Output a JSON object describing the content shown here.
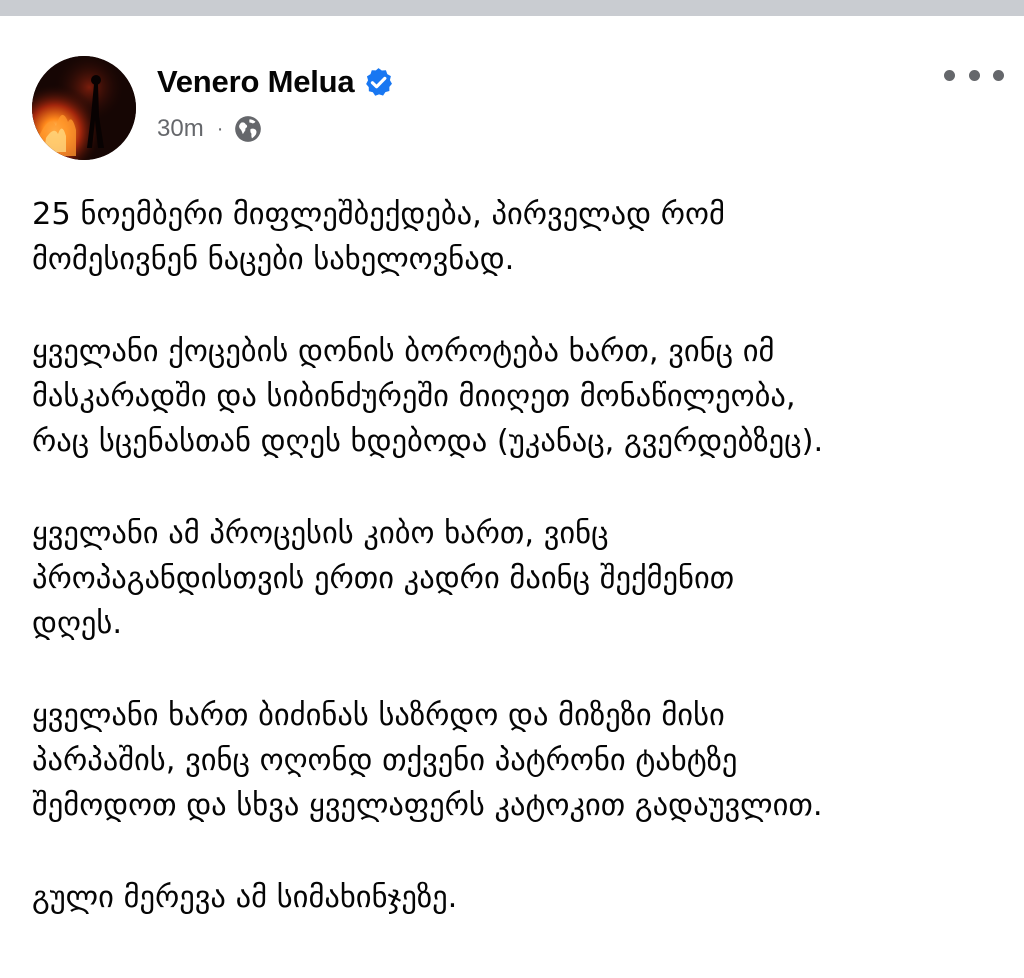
{
  "post": {
    "author": {
      "name": "Venero Melua",
      "verified": true,
      "avatar_icon": "profile-photo-fire"
    },
    "meta": {
      "time": "30m",
      "separator": "·",
      "audience_icon": "globe-icon"
    },
    "menu_icon": "more-options-icon",
    "paragraphs": [
      {
        "lines": [
          "25 ნოემბერი მიფლეშბექდება, პირველად რომ",
          "მომესივნენ ნაცები სახელოვნად."
        ]
      },
      {
        "lines": [
          "ყველანი ქოცების დონის ბოროტება ხართ, ვინც იმ",
          "მასკარადში და სიბინძურეში მიიღეთ მონაწილეობა,",
          "რაც სცენასთან დღეს ხდებოდა (უკანაც, გვერდებზეც)."
        ]
      },
      {
        "lines": [
          "ყველანი ამ პროცესის კიბო ხართ, ვინც",
          "პროპაგანდისთვის ერთი კადრი მაინც შექმენით",
          "დღეს."
        ]
      },
      {
        "lines": [
          "ყველანი ხართ ბიძინას საზრდო და მიზეზი მისი",
          "პარპაშის, ვინც ოღონდ თქვენი პატრონი ტახტზე",
          "შემოდოთ და სხვა ყველაფერს კატოკით გადაუვლით."
        ]
      },
      {
        "lines": [
          "გული მერევა ამ სიმახინჯეზე."
        ]
      }
    ]
  },
  "colors": {
    "verified_blue": "#1877f2",
    "secondary_text": "#65676b",
    "primary_text": "#050505",
    "top_strip": "#c9ccd1"
  }
}
